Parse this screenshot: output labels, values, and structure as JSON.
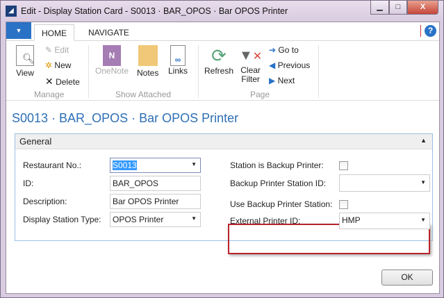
{
  "window": {
    "title": "Edit - Display Station Card - S0013 · BAR_OPOS · Bar OPOS Printer",
    "minimize": "▁",
    "maximize": "□",
    "close": "X"
  },
  "tabs": [
    "HOME",
    "NAVIGATE"
  ],
  "help": "?",
  "ribbon": {
    "manage": {
      "label": "Manage",
      "view": "View",
      "edit": "Edit",
      "new": "New",
      "delete": "Delete"
    },
    "attached": {
      "label": "Show Attached",
      "onenote": "OneNote",
      "notes": "Notes",
      "links": "Links"
    },
    "page": {
      "label": "Page",
      "refresh": "Refresh",
      "clear_filter_1": "Clear",
      "clear_filter_2": "Filter",
      "goto": "Go to",
      "previous": "Previous",
      "next": "Next"
    }
  },
  "heading": "S0013 · BAR_OPOS · Bar OPOS Printer",
  "general": {
    "title": "General",
    "restaurant_no": {
      "label": "Restaurant No.:",
      "value": "S0013"
    },
    "id": {
      "label": "ID:",
      "value": "BAR_OPOS"
    },
    "description": {
      "label": "Description:",
      "value": "Bar OPOS Printer"
    },
    "type": {
      "label": "Display Station Type:",
      "value": "OPOS Printer"
    },
    "backup_printer": {
      "label": "Station is Backup Printer:",
      "checked": false
    },
    "backup_station_id": {
      "label": "Backup Printer Station ID:",
      "value": ""
    },
    "use_backup": {
      "label": "Use Backup Printer Station:",
      "checked": false
    },
    "external_printer": {
      "label": "External Printer ID:",
      "value": "HMP"
    }
  },
  "ok": "OK"
}
